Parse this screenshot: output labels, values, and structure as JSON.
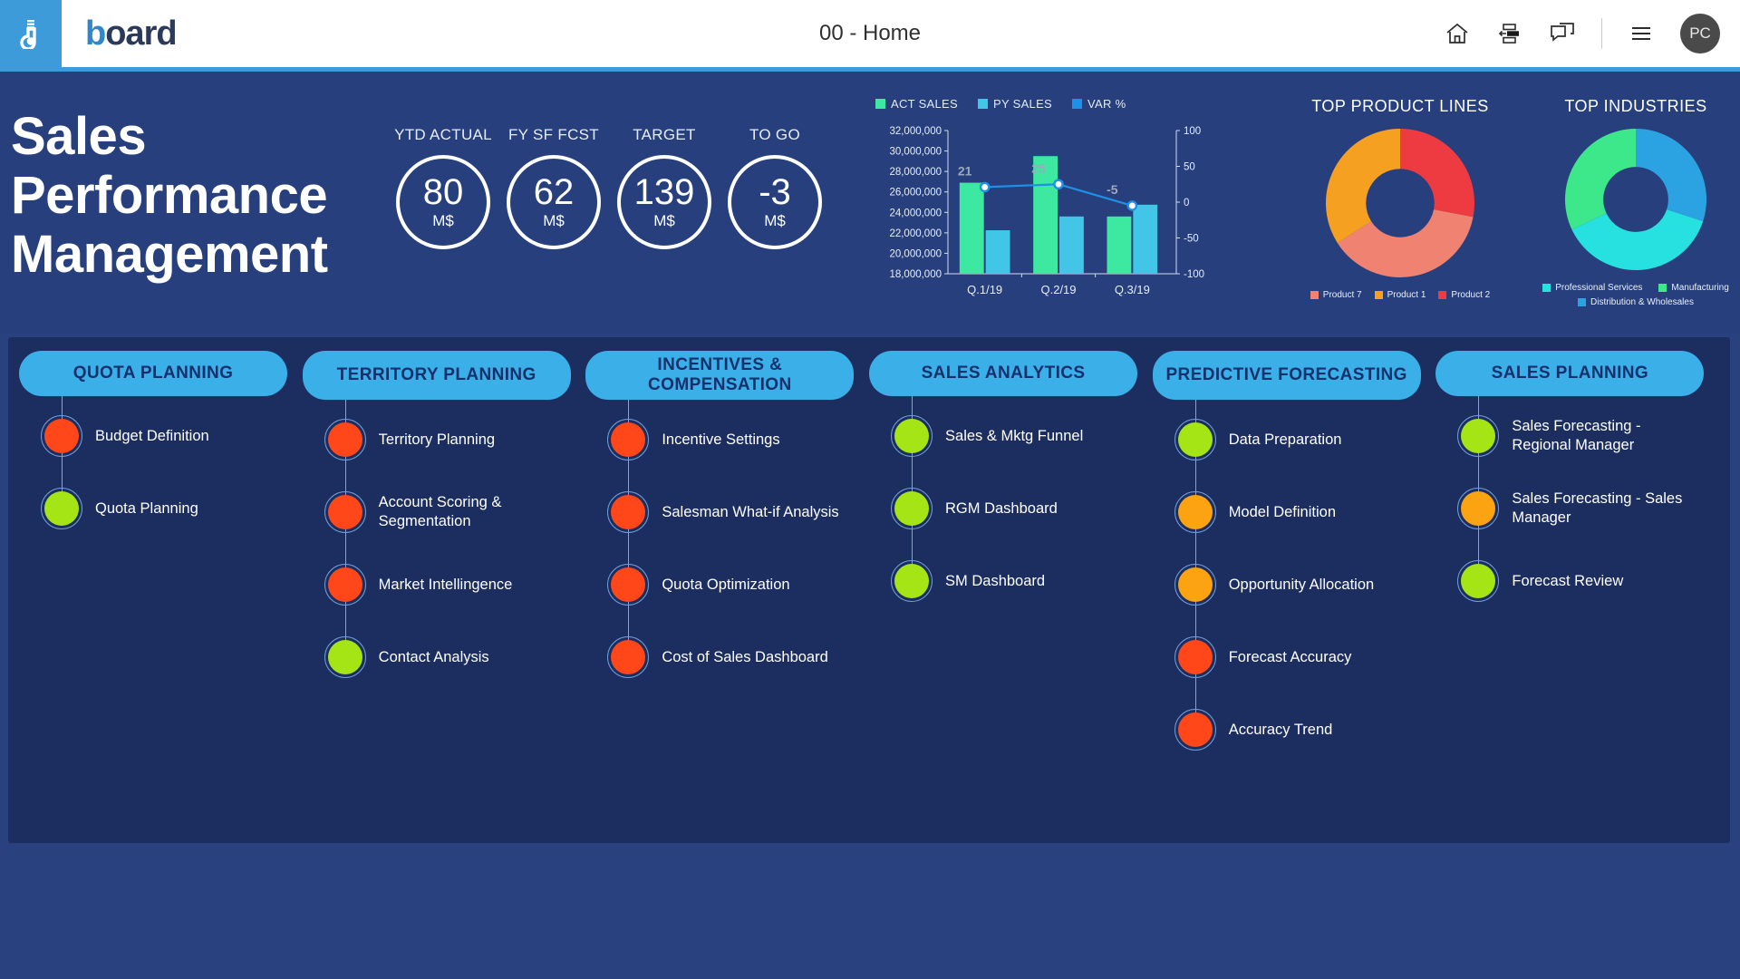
{
  "topbar": {
    "app_title": "00 - Home",
    "brand_prefix": "b",
    "brand_rest": "oard",
    "avatar_initials": "PC",
    "icons": [
      "home-icon",
      "layout-panel-icon",
      "chat-icon",
      "hamburger-menu-icon"
    ]
  },
  "hero": {
    "title_line1": "Sales",
    "title_line2": "Performance",
    "title_line3": "Management",
    "kpis": [
      {
        "label": "YTD ACTUAL",
        "value": "80",
        "unit": "M$"
      },
      {
        "label": "FY SF FCST",
        "value": "62",
        "unit": "M$"
      },
      {
        "label": "TARGET",
        "value": "139",
        "unit": "M$"
      },
      {
        "label": "TO GO",
        "value": "-3",
        "unit": "M$"
      }
    ]
  },
  "chart_data": {
    "type": "bar",
    "title": "",
    "categories": [
      "Q.1/19",
      "Q.2/19",
      "Q.3/19"
    ],
    "series": [
      {
        "name": "ACT SALES",
        "values": [
          26900000,
          29500000,
          23600000
        ],
        "color": "#3DE8A0"
      },
      {
        "name": "PY SALES",
        "values": [
          22250000,
          23600000,
          24750000
        ],
        "color": "#41C6E8"
      },
      {
        "name": "VAR %",
        "values": [
          21,
          25,
          -5
        ],
        "color": "#1E90E8",
        "axis": "secondary",
        "type": "line"
      }
    ],
    "ylabel": "",
    "xlabel": "",
    "ylim": [
      18000000,
      32000000
    ],
    "y_ticks": [
      "18,000,000",
      "20,000,000",
      "22,000,000",
      "24,000,000",
      "26,000,000",
      "28,000,000",
      "30,000,000",
      "32,000,000"
    ],
    "y2lim": [
      -100,
      100
    ],
    "y2_ticks": [
      "-100",
      "-50",
      "0",
      "50",
      "100"
    ],
    "data_labels": [
      "21",
      "25",
      "-5"
    ],
    "grid": false,
    "legend_position": "top"
  },
  "donuts": [
    {
      "title": "TOP PRODUCT LINES",
      "type": "pie",
      "slices": [
        {
          "label": "Product 2",
          "value": 28,
          "color": "#EE3B42"
        },
        {
          "label": "Product 7",
          "value": 38,
          "color": "#F08272"
        },
        {
          "label": "Product 1",
          "value": 34,
          "color": "#F5A020"
        }
      ],
      "legend_order": [
        {
          "label": "Product 7",
          "color": "#F08272"
        },
        {
          "label": "Product 1",
          "color": "#F5A020"
        },
        {
          "label": "Product 2",
          "color": "#EE3B42"
        }
      ]
    },
    {
      "title": "TOP INDUSTRIES",
      "type": "pie",
      "slices": [
        {
          "label": "Distribution & Wholesales",
          "value": 30,
          "color": "#2BA3E3"
        },
        {
          "label": "Professional Services",
          "value": 38,
          "color": "#27E0E0"
        },
        {
          "label": "Manufacturing",
          "value": 32,
          "color": "#3DE88A"
        }
      ],
      "legend_order": [
        {
          "label": "Professional Services",
          "color": "#27E0E0"
        },
        {
          "label": "Manufacturing",
          "color": "#3DE88A"
        },
        {
          "label": "Distribution & Wholesales",
          "color": "#2BA3E3"
        }
      ]
    }
  ],
  "nav": {
    "columns": [
      {
        "title": "QUOTA PLANNING",
        "two_line": false,
        "items": [
          {
            "label": "Budget Definition",
            "status_color": "#FF4719"
          },
          {
            "label": "Quota Planning",
            "status_color": "#A6E515"
          }
        ]
      },
      {
        "title": "TERRITORY PLANNING",
        "two_line": true,
        "items": [
          {
            "label": "Territory Planning",
            "status_color": "#FF4719"
          },
          {
            "label": "Account Scoring & Segmentation",
            "status_color": "#FF4719"
          },
          {
            "label": "Market Intellingence",
            "status_color": "#FF4719"
          },
          {
            "label": "Contact Analysis",
            "status_color": "#A6E515"
          }
        ]
      },
      {
        "title": "INCENTIVES & COMPENSATION",
        "two_line": true,
        "items": [
          {
            "label": "Incentive Settings",
            "status_color": "#FF4719"
          },
          {
            "label": "Salesman What-if Analysis",
            "status_color": "#FF4719"
          },
          {
            "label": "Quota Optimization",
            "status_color": "#FF4719"
          },
          {
            "label": "Cost of Sales Dashboard",
            "status_color": "#FF4719"
          }
        ]
      },
      {
        "title": "SALES ANALYTICS",
        "two_line": false,
        "items": [
          {
            "label": "Sales & Mktg Funnel",
            "status_color": "#A6E515"
          },
          {
            "label": "RGM Dashboard",
            "status_color": "#A6E515"
          },
          {
            "label": "SM Dashboard",
            "status_color": "#A6E515"
          }
        ]
      },
      {
        "title": "PREDICTIVE FORECASTING",
        "two_line": true,
        "items": [
          {
            "label": "Data Preparation",
            "status_color": "#A6E515"
          },
          {
            "label": "Model Definition",
            "status_color": "#FCA311"
          },
          {
            "label": "Opportunity Allocation",
            "status_color": "#FCA311"
          },
          {
            "label": "Forecast Accuracy",
            "status_color": "#FF4719"
          },
          {
            "label": "Accuracy Trend",
            "status_color": "#FF4719"
          }
        ]
      },
      {
        "title": "SALES PLANNING",
        "two_line": false,
        "items": [
          {
            "label": "Sales Forecasting - Regional Manager",
            "status_color": "#A6E515"
          },
          {
            "label": "Sales Forecasting - Sales Manager",
            "status_color": "#FCA311"
          },
          {
            "label": "Forecast Review",
            "status_color": "#A6E515"
          }
        ]
      }
    ]
  },
  "colors": {
    "brand_blue": "#3D9BD9",
    "hero_bg": "#27407D",
    "panel_bg": "#1C2E60",
    "page_bg": "#2A4180",
    "pill_bg": "#3AAFE8",
    "pill_text": "#16306B"
  }
}
